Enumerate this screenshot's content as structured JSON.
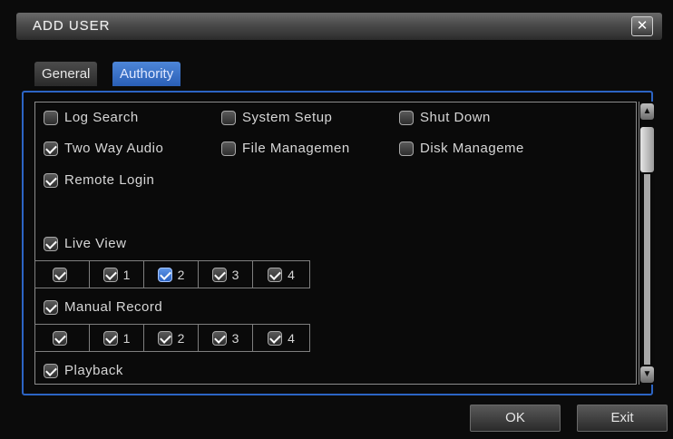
{
  "dialog": {
    "title": "ADD USER",
    "close_glyph": "✕"
  },
  "tabs": [
    {
      "label": "General",
      "active": false
    },
    {
      "label": "Authority",
      "active": true
    }
  ],
  "permissions": {
    "log_search": {
      "label": "Log Search",
      "checked": false
    },
    "system_setup": {
      "label": "System Setup",
      "checked": false
    },
    "shut_down": {
      "label": "Shut Down",
      "checked": false
    },
    "two_way_audio": {
      "label": "Two Way Audio",
      "checked": true
    },
    "file_management": {
      "label": "File Managemen",
      "checked": false
    },
    "disk_management": {
      "label": "Disk Manageme",
      "checked": false
    },
    "remote_login": {
      "label": "Remote Login",
      "checked": true
    },
    "live_view": {
      "label": "Live View",
      "checked": true
    },
    "manual_record": {
      "label": "Manual Record",
      "checked": true
    },
    "playback": {
      "label": "Playback",
      "checked": true
    }
  },
  "live_view_channels": [
    {
      "label": "",
      "checked": true,
      "highlight": false
    },
    {
      "label": "1",
      "checked": true,
      "highlight": false
    },
    {
      "label": "2",
      "checked": true,
      "highlight": true
    },
    {
      "label": "3",
      "checked": true,
      "highlight": false
    },
    {
      "label": "4",
      "checked": true,
      "highlight": false
    }
  ],
  "manual_record_channels": [
    {
      "label": "",
      "checked": true,
      "highlight": false
    },
    {
      "label": "1",
      "checked": true,
      "highlight": false
    },
    {
      "label": "2",
      "checked": true,
      "highlight": false
    },
    {
      "label": "3",
      "checked": true,
      "highlight": false
    },
    {
      "label": "4",
      "checked": true,
      "highlight": false
    }
  ],
  "scrollbar": {
    "up_icon": "▲",
    "down_icon": "▼"
  },
  "buttons": {
    "ok": "OK",
    "exit": "Exit"
  },
  "colors": {
    "accent": "#2c64c4",
    "tab_active": "#3a72cc",
    "background": "#0b0b0b"
  }
}
